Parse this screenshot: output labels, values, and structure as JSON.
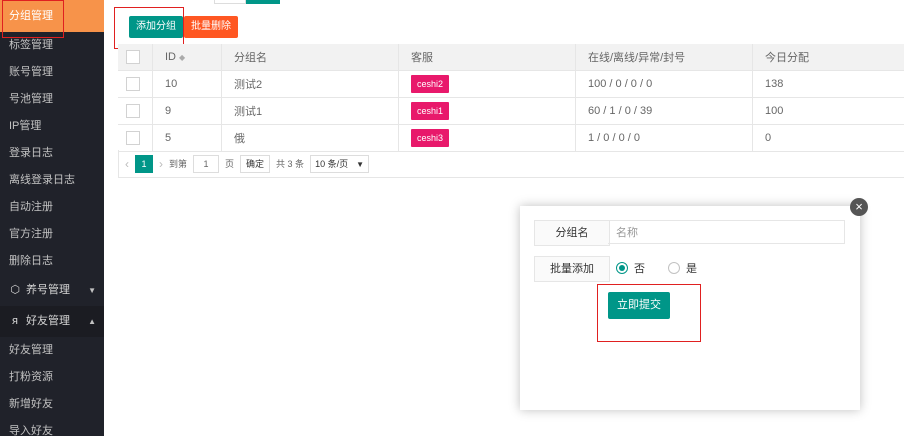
{
  "sidebar": {
    "items": [
      {
        "label": "分组管理",
        "active": true
      },
      {
        "label": "标签管理"
      },
      {
        "label": "账号管理"
      },
      {
        "label": "号池管理"
      },
      {
        "label": "IP管理"
      },
      {
        "label": "登录日志"
      },
      {
        "label": "离线登录日志"
      },
      {
        "label": "自动注册"
      },
      {
        "label": "官方注册"
      },
      {
        "label": "删除日志"
      }
    ],
    "group_raise": {
      "label": "养号管理",
      "icon": "cube-icon",
      "state": "collapsed"
    },
    "group_friend": {
      "label": "好友管理",
      "icon": "user-icon",
      "state": "expanded"
    },
    "friend_items": [
      {
        "label": "好友管理"
      },
      {
        "label": "打粉资源"
      },
      {
        "label": "新增好友"
      },
      {
        "label": "导入好友"
      }
    ]
  },
  "toolbar": {
    "add_label": "添加分组",
    "batch_delete_label": "批量删除"
  },
  "table": {
    "columns": [
      "ID",
      "分组名",
      "客服",
      "在线/离线/异常/封号",
      "今日分配"
    ],
    "rows": [
      {
        "id": "10",
        "name": "测试2",
        "agent": "ceshi2",
        "status": "100 / 0 / 0 / 0",
        "today": "138"
      },
      {
        "id": "9",
        "name": "测试1",
        "agent": "ceshi1",
        "status": "60 / 1 / 0 / 39",
        "today": "100"
      },
      {
        "id": "5",
        "name": "俄",
        "agent": "ceshi3",
        "status": "1 / 0 / 0 / 0",
        "today": "0"
      }
    ]
  },
  "pager": {
    "current": "1",
    "goto_label": "到第",
    "goto_value": "1",
    "page_label": "页",
    "confirm_label": "确定",
    "total_label": "共 3 条",
    "page_size": "10 条/页"
  },
  "modal": {
    "name_label": "分组名",
    "name_placeholder": "名称",
    "batch_label": "批量添加",
    "option_no": "否",
    "option_yes": "是",
    "selected": "否",
    "submit_label": "立即提交"
  },
  "colors": {
    "primary": "#009688",
    "danger": "#ff5722",
    "tag": "#e8196b",
    "sidebar_bg": "#20222a",
    "sidebar_active": "#f7934a"
  }
}
